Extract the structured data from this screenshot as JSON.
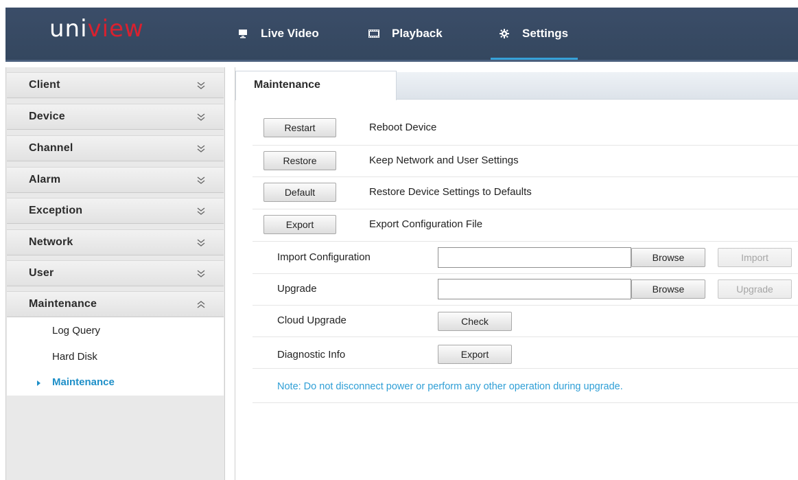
{
  "header": {
    "logo": {
      "part1": "uni",
      "part2": "view"
    },
    "nav": [
      {
        "label": "Live Video",
        "icon": "monitor-icon"
      },
      {
        "label": "Playback",
        "icon": "film-icon"
      },
      {
        "label": "Settings",
        "icon": "gear-icon",
        "active": true
      }
    ],
    "accent_color": "#36a2d8",
    "bg_color": "#3b4d68"
  },
  "sidebar": {
    "sections": [
      {
        "label": "Client",
        "expanded": false
      },
      {
        "label": "Device",
        "expanded": false
      },
      {
        "label": "Channel",
        "expanded": false
      },
      {
        "label": "Alarm",
        "expanded": false
      },
      {
        "label": "Exception",
        "expanded": false
      },
      {
        "label": "Network",
        "expanded": false
      },
      {
        "label": "User",
        "expanded": false
      },
      {
        "label": "Maintenance",
        "expanded": true
      }
    ],
    "maintenance_items": [
      {
        "label": "Log Query"
      },
      {
        "label": "Hard Disk"
      },
      {
        "label": "Maintenance",
        "active": true
      }
    ]
  },
  "main": {
    "tab": "Maintenance",
    "actions": [
      {
        "button": "Restart",
        "description": "Reboot Device"
      },
      {
        "button": "Restore",
        "description": "Keep Network and User Settings"
      },
      {
        "button": "Default",
        "description": "Restore Device Settings to Defaults"
      },
      {
        "button": "Export",
        "description": "Export Configuration File"
      }
    ],
    "import_config": {
      "label": "Import Configuration",
      "value": "",
      "browse": "Browse",
      "action": "Import"
    },
    "upgrade": {
      "label": "Upgrade",
      "value": "",
      "browse": "Browse",
      "action": "Upgrade"
    },
    "cloud_upgrade": {
      "label": "Cloud Upgrade",
      "button": "Check"
    },
    "diagnostic": {
      "label": "Diagnostic Info",
      "button": "Export"
    },
    "note": "Note: Do not disconnect power or perform any other operation during upgrade.",
    "note_color": "#2f9fd6"
  }
}
